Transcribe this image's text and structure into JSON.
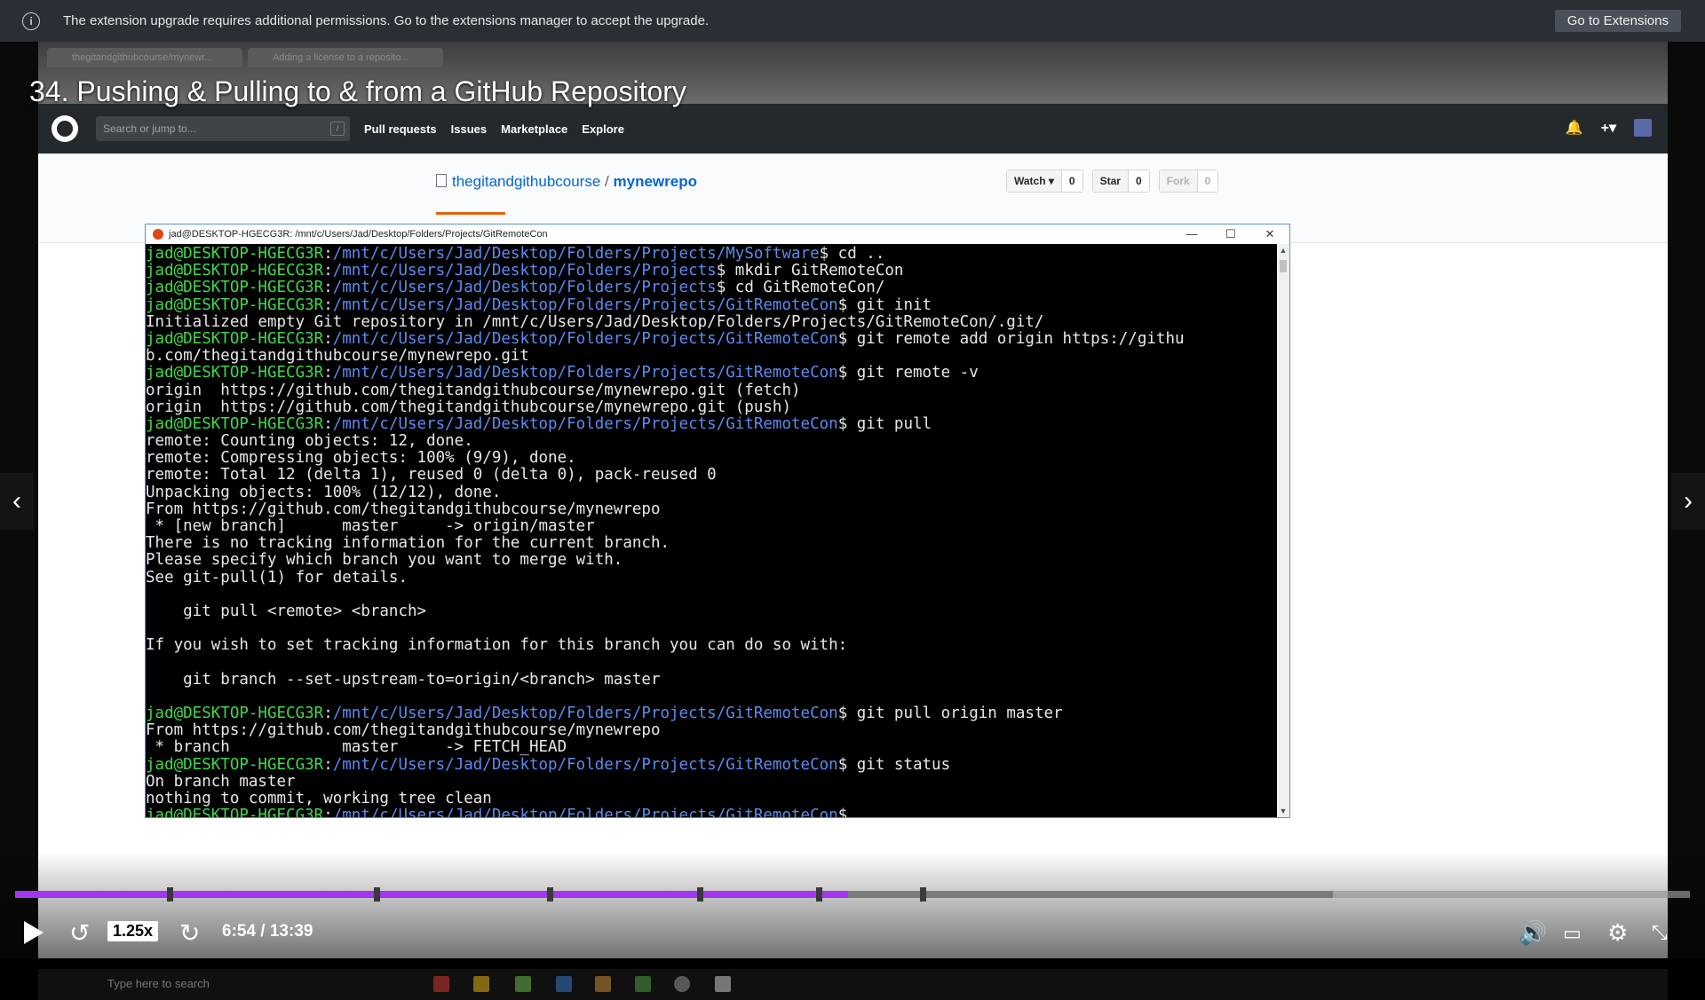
{
  "notification": {
    "message": "The extension upgrade requires additional permissions. Go to the extensions manager to accept the upgrade.",
    "button": "Go to Extensions"
  },
  "course": {
    "title": "34. Pushing & Pulling to & from a GitHub Repository"
  },
  "browser": {
    "tabs": [
      "thegitandgithubcourse/mynewr...",
      "Adding a license to a reposito..."
    ]
  },
  "github": {
    "search_placeholder": "Search or jump to...",
    "search_key": "/",
    "nav": [
      "Pull requests",
      "Issues",
      "Marketplace",
      "Explore"
    ],
    "repo_owner": "thegitandgithubcourse",
    "repo_sep": "/",
    "repo_name": "mynewrepo",
    "watch": {
      "label": "Watch ▾",
      "count": "0"
    },
    "star": {
      "label": "Star",
      "count": "0"
    },
    "fork": {
      "label": "Fork",
      "count": "0"
    }
  },
  "terminal": {
    "title": "jad@DESKTOP-HGECG3R: /mnt/c/Users/Jad/Desktop/Folders/Projects/GitRemoteCon",
    "lines": [
      {
        "u": "jad@DESKTOP-HGECG3R",
        "p": "/mnt/c/Users/Jad/Desktop/Folders/Projects/MySoftware",
        "c": "$ cd .."
      },
      {
        "u": "jad@DESKTOP-HGECG3R",
        "p": "/mnt/c/Users/Jad/Desktop/Folders/Projects",
        "c": "$ mkdir GitRemoteCon"
      },
      {
        "u": "jad@DESKTOP-HGECG3R",
        "p": "/mnt/c/Users/Jad/Desktop/Folders/Projects",
        "c": "$ cd GitRemoteCon/"
      },
      {
        "u": "jad@DESKTOP-HGECG3R",
        "p": "/mnt/c/Users/Jad/Desktop/Folders/Projects/GitRemoteCon",
        "c": "$ git init"
      },
      {
        "t": "Initialized empty Git repository in /mnt/c/Users/Jad/Desktop/Folders/Projects/GitRemoteCon/.git/"
      },
      {
        "u": "jad@DESKTOP-HGECG3R",
        "p": "/mnt/c/Users/Jad/Desktop/Folders/Projects/GitRemoteCon",
        "c": "$ git remote add origin https://githu"
      },
      {
        "t": "b.com/thegitandgithubcourse/mynewrepo.git"
      },
      {
        "u": "jad@DESKTOP-HGECG3R",
        "p": "/mnt/c/Users/Jad/Desktop/Folders/Projects/GitRemoteCon",
        "c": "$ git remote -v"
      },
      {
        "t": "origin  https://github.com/thegitandgithubcourse/mynewrepo.git (fetch)"
      },
      {
        "t": "origin  https://github.com/thegitandgithubcourse/mynewrepo.git (push)"
      },
      {
        "u": "jad@DESKTOP-HGECG3R",
        "p": "/mnt/c/Users/Jad/Desktop/Folders/Projects/GitRemoteCon",
        "c": "$ git pull"
      },
      {
        "t": "remote: Counting objects: 12, done."
      },
      {
        "t": "remote: Compressing objects: 100% (9/9), done."
      },
      {
        "t": "remote: Total 12 (delta 1), reused 0 (delta 0), pack-reused 0"
      },
      {
        "t": "Unpacking objects: 100% (12/12), done."
      },
      {
        "t": "From https://github.com/thegitandgithubcourse/mynewrepo"
      },
      {
        "t": " * [new branch]      master     -> origin/master"
      },
      {
        "t": "There is no tracking information for the current branch."
      },
      {
        "t": "Please specify which branch you want to merge with."
      },
      {
        "t": "See git-pull(1) for details."
      },
      {
        "t": ""
      },
      {
        "t": "    git pull <remote> <branch>"
      },
      {
        "t": ""
      },
      {
        "t": "If you wish to set tracking information for this branch you can do so with:"
      },
      {
        "t": ""
      },
      {
        "t": "    git branch --set-upstream-to=origin/<branch> master"
      },
      {
        "t": ""
      },
      {
        "u": "jad@DESKTOP-HGECG3R",
        "p": "/mnt/c/Users/Jad/Desktop/Folders/Projects/GitRemoteCon",
        "c": "$ git pull origin master"
      },
      {
        "t": "From https://github.com/thegitandgithubcourse/mynewrepo"
      },
      {
        "t": " * branch            master     -> FETCH_HEAD"
      },
      {
        "u": "jad@DESKTOP-HGECG3R",
        "p": "/mnt/c/Users/Jad/Desktop/Folders/Projects/GitRemoteCon",
        "c": "$ git status"
      },
      {
        "t": "On branch master"
      },
      {
        "t": "nothing to commit, working tree clean"
      },
      {
        "u": "jad@DESKTOP-HGECG3R",
        "p": "/mnt/c/Users/Jad/Desktop/Folders/Projects/GitRemoteCon",
        "c": "$"
      }
    ]
  },
  "player": {
    "speed": "1.25x",
    "time": "6:54 / 13:39",
    "progress_fraction": 0.4975,
    "buffered_fraction": 0.787,
    "chapter_marks": [
      0.092,
      0.216,
      0.319,
      0.409,
      0.48,
      0.542
    ],
    "accent_color": "#a435f0"
  },
  "taskbar": {
    "search_placeholder": "Type here to search"
  }
}
